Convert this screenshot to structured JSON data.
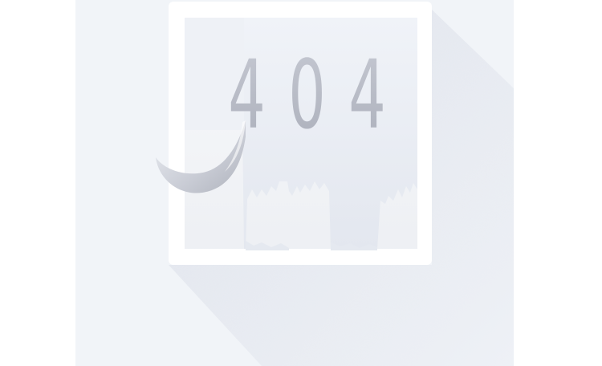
{
  "error": {
    "code": "404",
    "digits": [
      "4",
      "0",
      "4"
    ]
  },
  "colors": {
    "background": "#ffffff",
    "panel": "#f1f4f8",
    "frame": "#ffffff",
    "paper": "#e9edf4",
    "digits": "#b8bcc7",
    "shadow": "#e2e6ee"
  }
}
